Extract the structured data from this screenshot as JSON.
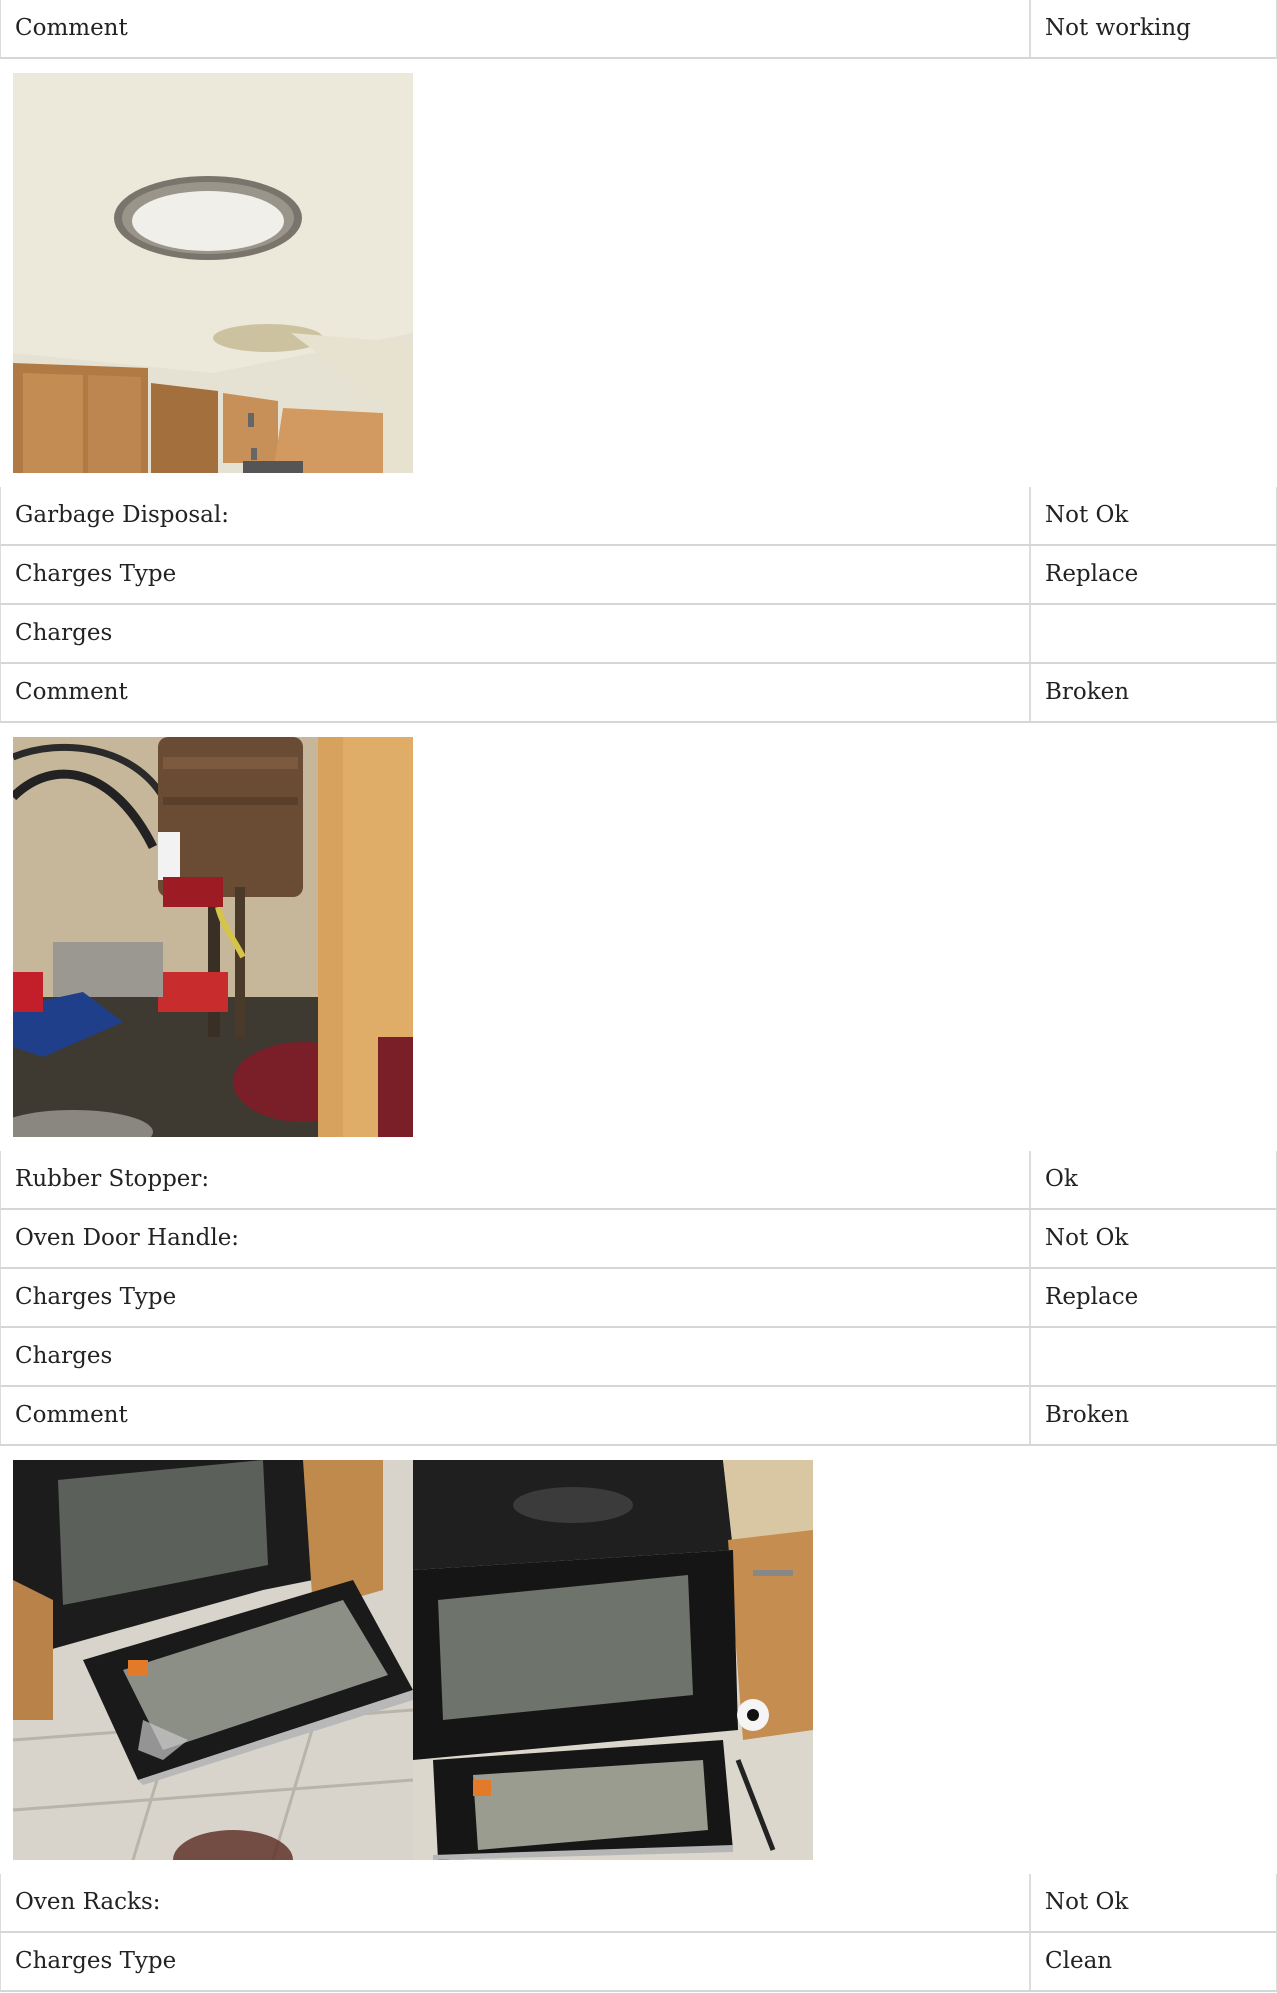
{
  "rows_block_1": [
    {
      "label": "Comment",
      "value": "Not working"
    }
  ],
  "photo_block_1": {
    "photos": [
      "ceiling-light-photo"
    ]
  },
  "rows_block_2": [
    {
      "label": "Garbage Disposal:",
      "value": "Not Ok"
    },
    {
      "label": "Charges Type",
      "value": "Replace"
    },
    {
      "label": "Charges",
      "value": ""
    },
    {
      "label": "Comment",
      "value": "Broken"
    }
  ],
  "photo_block_2": {
    "photos": [
      "garbage-disposal-photo"
    ]
  },
  "rows_block_3": [
    {
      "label": "Rubber Stopper:",
      "value": "Ok"
    },
    {
      "label": "Oven Door Handle:",
      "value": "Not Ok"
    },
    {
      "label": "Charges Type",
      "value": "Replace"
    },
    {
      "label": "Charges",
      "value": ""
    },
    {
      "label": "Comment",
      "value": "Broken"
    }
  ],
  "photo_block_3": {
    "photos": [
      "oven-door-photo-1",
      "oven-door-photo-2"
    ]
  },
  "rows_block_4": [
    {
      "label": "Oven Racks:",
      "value": "Not Ok"
    },
    {
      "label": "Charges Type",
      "value": "Clean"
    }
  ],
  "colors": {
    "border": "#d6d6d6",
    "text": "#222222",
    "background": "#ffffff"
  }
}
